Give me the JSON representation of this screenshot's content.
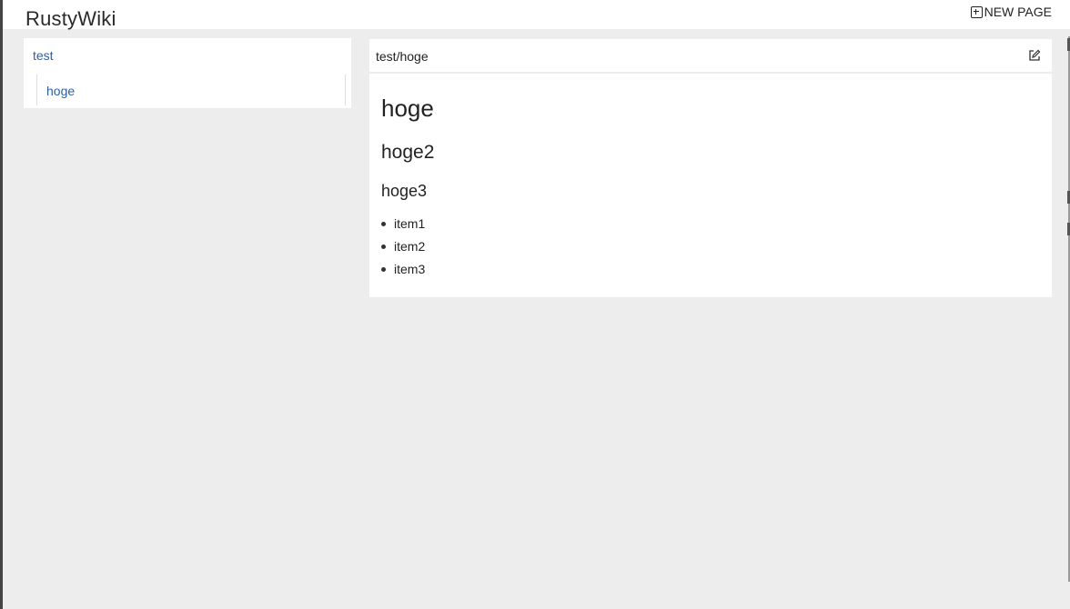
{
  "header": {
    "app_title": "RustyWiki",
    "new_page_label": "NEW PAGE"
  },
  "sidebar": {
    "tree": {
      "root_label": "test",
      "children": [
        {
          "label": "hoge"
        }
      ]
    }
  },
  "page": {
    "path": "test/hoge",
    "content": {
      "h1": "hoge",
      "h2": "hoge2",
      "h3": "hoge3",
      "items": [
        "item1",
        "item2",
        "item3"
      ]
    }
  },
  "icons": {
    "new_page": "plus-square-icon",
    "edit": "edit-icon"
  }
}
